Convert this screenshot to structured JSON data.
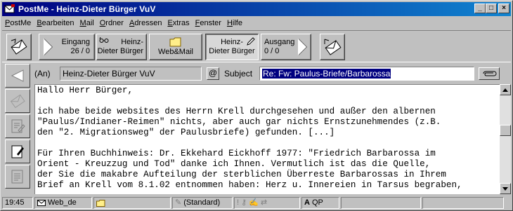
{
  "window": {
    "title": "PostMe - Heinz-Dieter Bürger VuV",
    "controls": {
      "minimize": "_",
      "maximize": "□",
      "close": "×"
    }
  },
  "menu": [
    {
      "label": "PostMe"
    },
    {
      "label": "Bearbeiten"
    },
    {
      "label": "Mail"
    },
    {
      "label": "Ordner"
    },
    {
      "label": "Adressen"
    },
    {
      "label": "Extras"
    },
    {
      "label": "Fenster"
    },
    {
      "label": "Hilfe"
    }
  ],
  "toolbar": {
    "inbox_label": "Eingang",
    "inbox_count": "26 / 0",
    "person_line1": "Heinz-",
    "person_line2": "Dieter Bürger",
    "webmail_label": "Web&Mail",
    "compose_line1": "Heinz-",
    "compose_line2": "Dieter Bürger",
    "outbox_label": "Ausgang",
    "outbox_count": "0 / 0"
  },
  "header": {
    "to_label": "(An)",
    "to_value": "Heinz-Dieter Bürger VuV",
    "at_button": "@",
    "subject_label": "Subject",
    "subject_value": "Re: Fw: Paulus-Briefe/Barbarossa"
  },
  "body_lines": [
    "Hallo Herr Bürger,",
    "",
    "ich habe beide websites des Herrn Krell durchgesehen und außer den albernen",
    "\"Paulus/Indianer-Reimen\" nichts, aber auch gar nichts Ernstzunehmendes (z.B.",
    "den \"2. Migrationsweg\" der Paulusbriefe) gefunden. [...]",
    "",
    "Für Ihren Buchhinweis: Dr. Ekkehard Eickhoff 1977: \"Friedrich Barbarossa im",
    "Orient - Kreuzzug und Tod\" danke ich Ihnen. Vermutlich ist das die Quelle,",
    "der Sie die makabre Aufteilung der sterblichen Überreste Barbarossas in Ihrem",
    "Brief an Krell vom 8.1.02 entnommen haben: Herz u. Innereien in Tarsus begraben,"
  ],
  "statusbar": {
    "time": "19:45",
    "account": "Web_de",
    "folder": "",
    "style": "(Standard)",
    "encoding": "QP"
  },
  "colors": {
    "titlebar_start": "#000080",
    "titlebar_end": "#1084d0",
    "selection": "#000080",
    "face": "#c0c0c0"
  }
}
